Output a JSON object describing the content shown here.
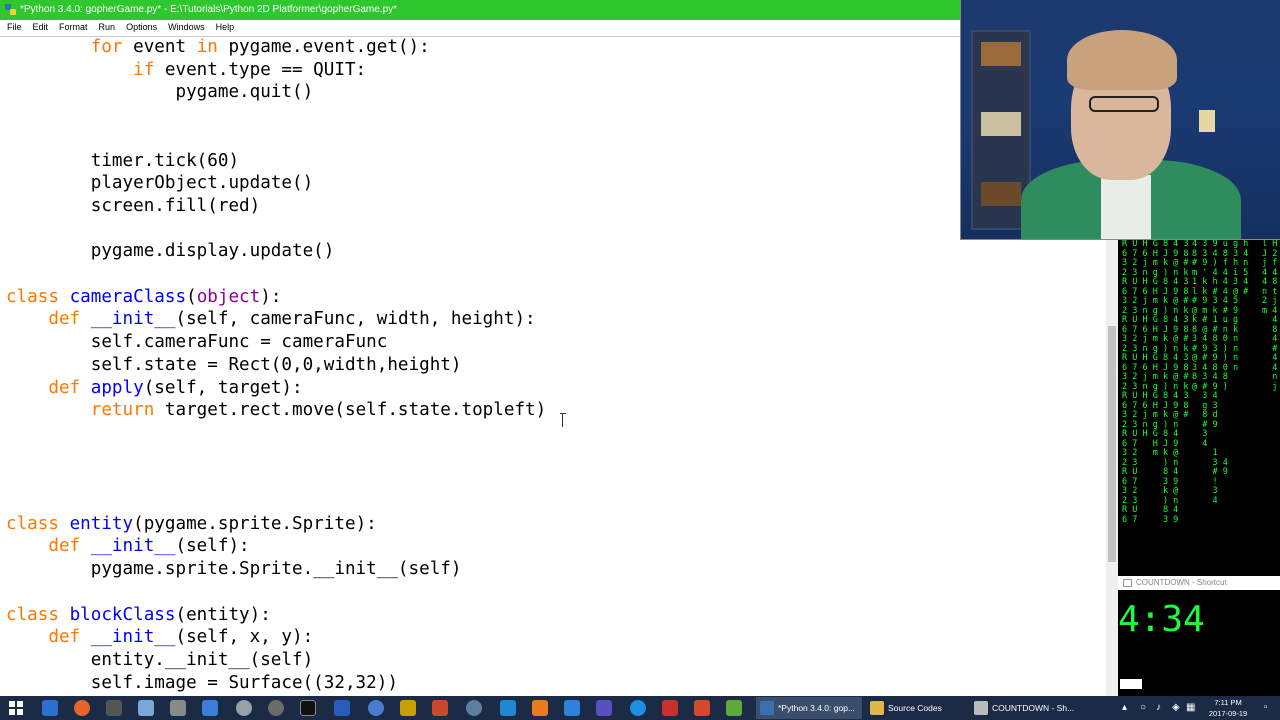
{
  "window": {
    "title": "*Python 3.4.0: gopherGame.py* - E:\\Tutorials\\Python 2D Platformer\\gopherGame.py*"
  },
  "menu": [
    "File",
    "Edit",
    "Format",
    "Run",
    "Options",
    "Windows",
    "Help"
  ],
  "code_lines": [
    [
      {
        "t": "        "
      },
      {
        "t": "for",
        "c": "kw"
      },
      {
        "t": " event "
      },
      {
        "t": "in",
        "c": "kw"
      },
      {
        "t": " pygame.event.get():"
      }
    ],
    [
      {
        "t": "            "
      },
      {
        "t": "if",
        "c": "kw"
      },
      {
        "t": " event.type == QUIT:"
      }
    ],
    [
      {
        "t": "                pygame.quit()"
      }
    ],
    [
      {
        "t": ""
      }
    ],
    [
      {
        "t": ""
      }
    ],
    [
      {
        "t": "        timer.tick(60)"
      }
    ],
    [
      {
        "t": "        playerObject.update()"
      }
    ],
    [
      {
        "t": "        screen.fill(red)"
      }
    ],
    [
      {
        "t": ""
      }
    ],
    [
      {
        "t": "        pygame.display.update()"
      }
    ],
    [
      {
        "t": ""
      }
    ],
    [
      {
        "t": "class",
        "c": "kw"
      },
      {
        "t": " "
      },
      {
        "t": "cameraClass",
        "c": "fn"
      },
      {
        "t": "("
      },
      {
        "t": "object",
        "c": "bi"
      },
      {
        "t": "):"
      }
    ],
    [
      {
        "t": "    "
      },
      {
        "t": "def",
        "c": "kw"
      },
      {
        "t": " "
      },
      {
        "t": "__init__",
        "c": "fn"
      },
      {
        "t": "(self, cameraFunc, width, height):"
      }
    ],
    [
      {
        "t": "        self.cameraFunc = cameraFunc"
      }
    ],
    [
      {
        "t": "        self.state = Rect(0,0,width,height)"
      }
    ],
    [
      {
        "t": "    "
      },
      {
        "t": "def",
        "c": "kw"
      },
      {
        "t": " "
      },
      {
        "t": "apply",
        "c": "fn"
      },
      {
        "t": "(self, target):"
      }
    ],
    [
      {
        "t": "        "
      },
      {
        "t": "return",
        "c": "kw"
      },
      {
        "t": " target.rect.move(self.state.topleft)"
      }
    ],
    [
      {
        "t": ""
      }
    ],
    [
      {
        "t": ""
      }
    ],
    [
      {
        "t": ""
      }
    ],
    [
      {
        "t": ""
      }
    ],
    [
      {
        "t": "class",
        "c": "kw"
      },
      {
        "t": " "
      },
      {
        "t": "entity",
        "c": "fn"
      },
      {
        "t": "(pygame.sprite.Sprite):"
      }
    ],
    [
      {
        "t": "    "
      },
      {
        "t": "def",
        "c": "kw"
      },
      {
        "t": " "
      },
      {
        "t": "__init__",
        "c": "fn"
      },
      {
        "t": "(self):"
      }
    ],
    [
      {
        "t": "        pygame.sprite.Sprite.__init__(self)"
      }
    ],
    [
      {
        "t": ""
      }
    ],
    [
      {
        "t": "class",
        "c": "kw"
      },
      {
        "t": " "
      },
      {
        "t": "blockClass",
        "c": "fn"
      },
      {
        "t": "(entity):"
      }
    ],
    [
      {
        "t": "    "
      },
      {
        "t": "def",
        "c": "kw"
      },
      {
        "t": " "
      },
      {
        "t": "__init__",
        "c": "fn"
      },
      {
        "t": "(self, x, y):"
      }
    ],
    [
      {
        "t": "        entity.__init__(self)"
      }
    ],
    [
      {
        "t": "        self.image = Surface((32,32))"
      }
    ]
  ],
  "matrix_columns": [
    "R U H G 8 4 3\n6 7 6 H J 9 8\n3 2 j m k @ #\n2 3 n g ) n k\nR U H G 8 4 3\n6 7 6 H J 9 8\n3 2 j m k @ #\n2 3 n g ) n k\nR U H G 8 4 3\n6 7 6 H J 9 8\n3 2 j m k @ #\n2 3 n g ) n k\nR U H G 8 4 3\n6 7 6 H J 9 8\n3 2 j m k @ #\n2 3 n g ) n k\nR U H G 8 4 3\n6 7 6 H J 9 8\n3 2 j m k @ #\n2 3 n g ) n\nR U H G 8 4\n6 7   H J 9\n3 2   m k @\n2 3     ) n\nR U     8 4\n6 7     3 9\n3 2     k @\n2 3     ) n\nR U     8 4\n6 7     3 9",
    "4 3 9 u g h\n8 3 4 8 3 4\n# 9 ) f h n\nm ' 4 4 i 5\n1 k h 4 3 4\nl k # 4 @ #\n# 9 3 4 5\n@ m k # 9\nk # 1 u g\n8 @ # n k\n3 4 8 0 n\n# 9 3 ) n\n@ # 9 ) n\n3 4 8 0 n\n8 3 4 8\n@ # 9 )\n  3 4\n  g 3\n  8 d\n  # 9\n  3\n  4\n    1\n    3 4\n    # 9\n    !\n    3\n    4",
    "l H\nJ 2\nj f\n4 4\n4 8\nn t\n2 j\nm 4\n  4\n  8\n  4\n  #\n  4\n  4\n  n\n  j"
  ],
  "countdown": {
    "window_title": "COUNTDOWN - Shortcut",
    "time": "4:34"
  },
  "taskbar": {
    "apps": [
      {
        "label": "*Python 3.4.0: gop...",
        "active": true
      },
      {
        "label": "Source Codes",
        "active": false
      },
      {
        "label": "COUNTDOWN - Sh...",
        "active": false
      }
    ],
    "clock_time": "7:11 PM",
    "clock_date": "2017-09-19"
  },
  "colors": {
    "titlebar": "#2ec72e",
    "keyword": "#ff7700",
    "definition": "#0000ff",
    "builtin": "#900090",
    "matrix_green": "#1aff3a",
    "taskbar": "#1b2b46"
  }
}
